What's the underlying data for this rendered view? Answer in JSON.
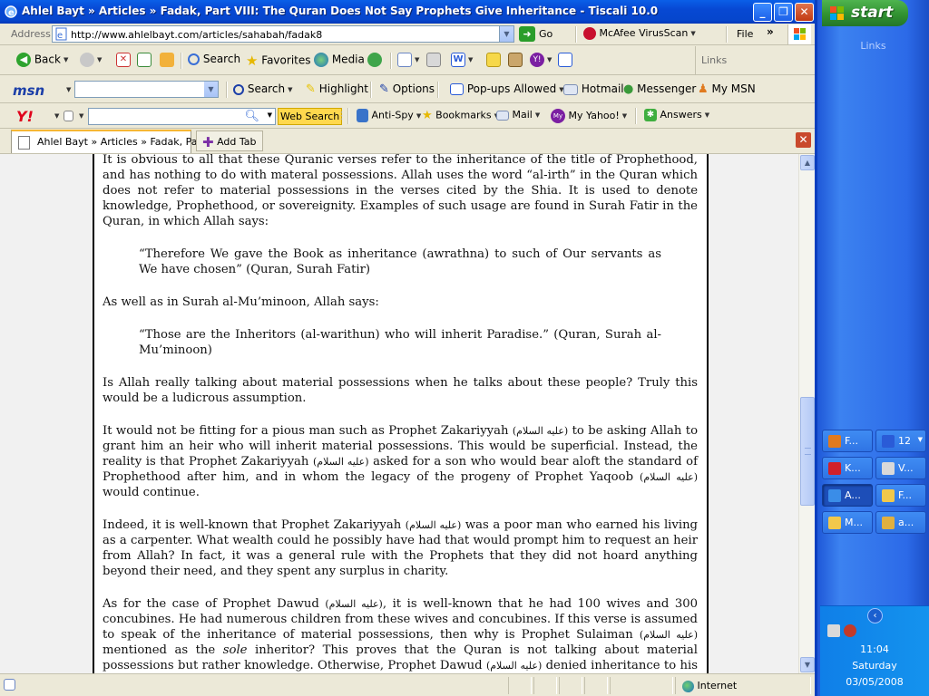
{
  "window": {
    "title": "Ahlel Bayt » Articles » Fadak, Part VIII: The Quran Does Not Say Prophets Give Inheritance - Tiscali 10.0",
    "controls": {
      "minimize": "_",
      "maximize": "❐",
      "close": "✕"
    }
  },
  "address_bar": {
    "label": "Address",
    "url": "http://www.ahlelbayt.com/articles/sahabah/fadak8",
    "go_label": "Go",
    "mcafee_label": "McAfee VirusScan",
    "file_menu": "File",
    "chevron": "»"
  },
  "standard_toolbar": {
    "back_label": "Back",
    "search_label": "Search",
    "favorites_label": "Favorites",
    "media_label": "Media",
    "links_label": "Links"
  },
  "msn_toolbar": {
    "logo": "msn",
    "search_label": "Search",
    "highlight_label": "Highlight",
    "options_label": "Options",
    "popups_label": "Pop-ups Allowed",
    "hotmail_label": "Hotmail",
    "messenger_label": "Messenger",
    "mymsn_label": "My MSN"
  },
  "yahoo_toolbar": {
    "logo": "Y!",
    "web_search_label": "Web Search",
    "antispy_label": "Anti-Spy",
    "bookmarks_label": "Bookmarks",
    "mail_label": "Mail",
    "myyahoo_label": "My Yahoo!",
    "answers_label": "Answers"
  },
  "tabs": {
    "active_tab_label": "Ahlel Bayt » Articles » Fadak, Pa...",
    "add_tab_label": "Add Tab"
  },
  "article": {
    "p1": "It is obvious to all that these Quranic verses refer to the inheritance of the title of Prophethood, and has nothing to do with materal possessions. Allah uses the word “al-irth” in the Quran which does not refer to material possessions in the verses cited by the Shia. It is used to denote knowledge, Prophethood, or sovereignity. Examples of such usage are found in Surah Fatir in the Quran, in which Allah says:",
    "quote1": "“Therefore We gave the Book as inheritance (awrathna) to such of Our servants as We have chosen” (Quran, Surah Fatir)",
    "p2": "As well as in Surah al-Mu’minoon, Allah says:",
    "quote2": "“Those are the Inheritors (al-warithun) who will inherit Paradise.” (Quran, Surah al-Mu’minoon)",
    "p3": "Is Allah really talking about material possessions when he talks about these people? Truly this would be a ludicrous assumption.",
    "honorific": "(عليه السلام)",
    "p4_a": "It would not be fitting for a pious man such as Prophet Zakariyyah ",
    "p4_b": " to be asking Allah to grant him an heir who will inherit material possessions. This would be superficial. Instead, the reality is that Prophet Zakariyyah ",
    "p4_c": " asked for a son who would bear aloft the standard of Prophethood after him, and in whom the legacy of the progeny of Prophet Yaqoob ",
    "p4_d": " would continue.",
    "p5_a": "Indeed, it is well-known that Prophet Zakariyyah ",
    "p5_b": " was a poor man who earned his living as a carpenter. What wealth could he possibly have had that would prompt him to request an heir from Allah? In fact, it was a general rule with the Prophets that they did not hoard anything beyond their need, and they spent any surplus in charity.",
    "p6_a": "As for the case of Prophet Dawud ",
    "p6_b": ", it is well-known that he had 100 wives and 300 concubines. He had numerous children from these wives and concubines. If this verse is assumed to speak of the inheritance of material possessions, then why is Prophet Sulaiman ",
    "p6_c": " mentioned as the ",
    "p6_sole": "sole",
    "p6_d": " inheritor? This proves that the Quran is not talking about material possessions but rather knowledge. Otherwise, Prophet Dawud ",
    "p6_e": " denied inheritance to his other children, and this would violate the Shia rhetoric which state that people cannot deny inheritance to the children of Prophets."
  },
  "status_bar": {
    "zone_label": "Internet"
  },
  "taskbar": {
    "start_label": "start",
    "links_label": "Links",
    "tasks": [
      {
        "label": "F...",
        "icon": "firefox-icon",
        "color": "#e07a1f"
      },
      {
        "label": "12",
        "icon": "word-icon",
        "color": "#2a5bd7"
      },
      {
        "label": "K...",
        "icon": "k-icon",
        "color": "#d0202a"
      },
      {
        "label": "V...",
        "icon": "doc-icon",
        "color": "#d9d9d9"
      },
      {
        "label": "A...",
        "icon": "ie-icon",
        "color": "#3a8de8"
      },
      {
        "label": "F...",
        "icon": "folder-icon",
        "color": "#f2c84b"
      },
      {
        "label": "M...",
        "icon": "folder-icon",
        "color": "#f2c84b"
      },
      {
        "label": "a...",
        "icon": "paint-icon",
        "color": "#e0b040"
      }
    ],
    "collapse": "‹",
    "clock_time": "11:04",
    "clock_day": "Saturday",
    "clock_date": "03/05/2008"
  }
}
